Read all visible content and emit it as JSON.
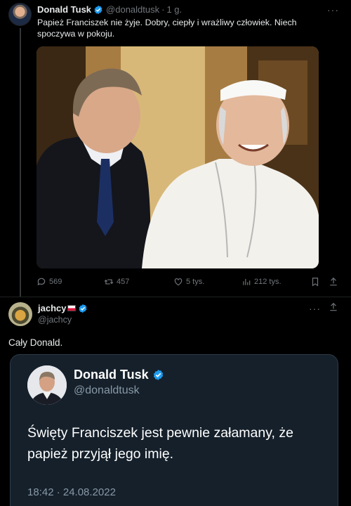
{
  "tweet": {
    "author_name": "Donald Tusk",
    "author_handle": "@donaldtusk",
    "separator": "·",
    "time": "1 g.",
    "more": "···",
    "text": "Papież Franciszek nie żyje. Dobry, ciepły i wrażliwy człowiek. Niech spoczywa w pokoju.",
    "stats": {
      "replies": "569",
      "reposts": "457",
      "likes": "5 tys.",
      "views": "212 tys."
    }
  },
  "reply": {
    "author_name": "jachcy",
    "author_handle": "@jachcy",
    "more": "···",
    "text": "Cały Donald."
  },
  "quoted": {
    "author_name": "Donald Tusk",
    "author_handle": "@donaldtusk",
    "text": "Święty Franciszek jest pewnie załamany, że papież przyjął jego imię.",
    "timestamp": "18:42 · 24.08.2022"
  },
  "colors": {
    "background": "#000000",
    "verified": "#1d9bf0",
    "muted": "#71767b",
    "card": "#15202b"
  },
  "icons": [
    "reply-icon",
    "repost-icon",
    "like-icon",
    "views-icon",
    "bookmark-icon",
    "share-icon",
    "verified-badge-icon",
    "poland-flag-icon"
  ]
}
